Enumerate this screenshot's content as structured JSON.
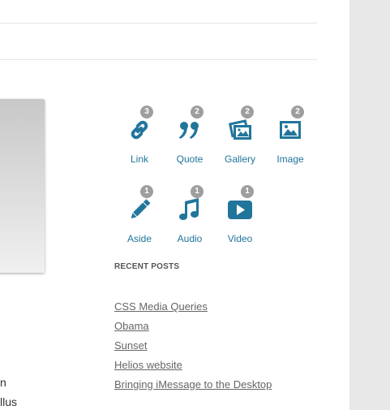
{
  "post_formats": [
    {
      "label": "Link",
      "count": "3",
      "icon": "link-icon"
    },
    {
      "label": "Quote",
      "count": "2",
      "icon": "quote-icon"
    },
    {
      "label": "Gallery",
      "count": "2",
      "icon": "gallery-icon"
    },
    {
      "label": "Image",
      "count": "2",
      "icon": "image-icon"
    },
    {
      "label": "Aside",
      "count": "1",
      "icon": "pencil-icon"
    },
    {
      "label": "Audio",
      "count": "1",
      "icon": "music-note-icon"
    },
    {
      "label": "Video",
      "count": "1",
      "icon": "video-play-icon"
    }
  ],
  "recent_posts": {
    "title": "RECENT POSTS",
    "items": [
      "CSS Media Queries",
      "Obama",
      "Sunset",
      "Helios website",
      "Bringing iMessage to the Desktop"
    ]
  },
  "fragments": [
    "n",
    "llus"
  ],
  "colors": {
    "icon": "#21759b",
    "badge": "#9e9e9e",
    "link": "#666666"
  }
}
